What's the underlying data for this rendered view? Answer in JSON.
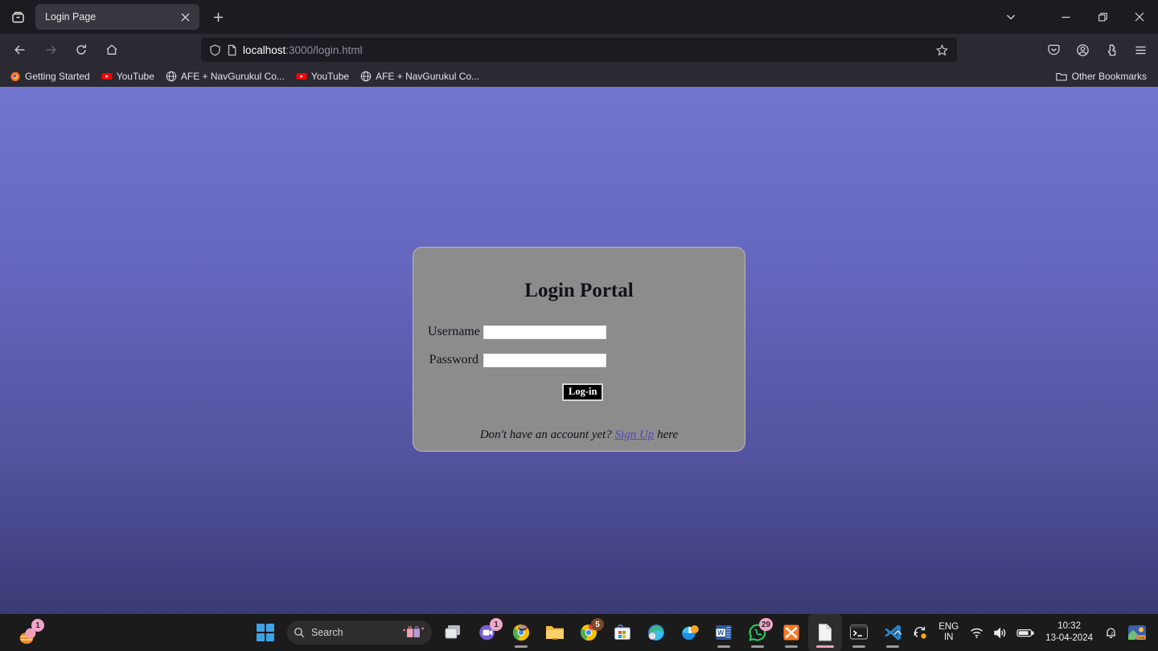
{
  "browser": {
    "window_controls": [
      {
        "name": "list-all-tabs",
        "icon": "chevron-down-icon"
      },
      {
        "name": "minimize",
        "icon": "minimize-icon"
      },
      {
        "name": "maximize",
        "icon": "restore-icon"
      },
      {
        "name": "close",
        "icon": "close-icon"
      }
    ],
    "firefox_view_tooltip": "Firefox View",
    "tab": {
      "title": "Login Page",
      "close_label": "×"
    },
    "new_tab_label": "+",
    "nav": {
      "back": "back-arrow",
      "forward": "forward-arrow",
      "reload": "reload-icon",
      "home": "home-icon"
    },
    "url": {
      "host": "localhost",
      "path": ":3000/login.html",
      "full": "localhost:3000/login.html",
      "shield_icon": "shield-icon",
      "page_icon": "page-icon",
      "bookmark_star": "star-icon"
    },
    "toolbar_right": [
      {
        "name": "pocket-icon",
        "label": "Save to Pocket"
      },
      {
        "name": "account-icon",
        "label": "Account"
      },
      {
        "name": "extensions-icon",
        "label": "Extensions"
      },
      {
        "name": "menu-icon",
        "label": "Open application menu"
      }
    ],
    "bookmarks": [
      {
        "label": "Getting Started",
        "icon": "firefox-icon"
      },
      {
        "label": "YouTube",
        "icon": "youtube-icon"
      },
      {
        "label": "AFE + NavGurukul Co...",
        "icon": "globe-icon"
      },
      {
        "label": "YouTube",
        "icon": "youtube-icon"
      },
      {
        "label": "AFE + NavGurukul Co...",
        "icon": "globe-icon"
      }
    ],
    "other_bookmarks": {
      "label": "Other Bookmarks",
      "icon": "folder-icon"
    }
  },
  "page": {
    "background_top": "#7175ce",
    "background_bottom": "#3a3a74",
    "card": {
      "background": "#8c8c8c",
      "title": "Login Portal",
      "fields": [
        {
          "label": "Username",
          "value": "",
          "placeholder": "",
          "type": "text"
        },
        {
          "label": "Password",
          "value": "",
          "placeholder": "",
          "type": "password"
        }
      ],
      "submit_label": "Log-in",
      "footer": {
        "prefix": "Don't have an account yet?",
        "link": "Sign Up",
        "suffix": "here",
        "link_color": "#4b48c4"
      }
    }
  },
  "taskbar": {
    "corner_app": {
      "name": "notification-app",
      "badge": "1"
    },
    "start_label": "Start",
    "search": {
      "placeholder": "Search",
      "icon": "search-icon"
    },
    "items": [
      {
        "name": "task-view",
        "badge": "",
        "active": false
      },
      {
        "name": "teams",
        "badge": "1",
        "active": false
      },
      {
        "name": "chrome-dev",
        "badge": "",
        "active": true
      },
      {
        "name": "file-explorer",
        "badge": "",
        "active": false
      },
      {
        "name": "chrome",
        "badge": "5",
        "active": false
      },
      {
        "name": "microsoft-store",
        "badge": "",
        "active": false
      },
      {
        "name": "edge",
        "badge": "",
        "active": false
      },
      {
        "name": "paint-3d",
        "badge": "",
        "active": false
      },
      {
        "name": "word",
        "badge": "",
        "active": true
      },
      {
        "name": "whatsapp",
        "badge": "29",
        "active": true
      },
      {
        "name": "xampp",
        "badge": "",
        "active": true
      },
      {
        "name": "notepad",
        "badge": "",
        "active": true,
        "focused": true
      },
      {
        "name": "terminal",
        "badge": "",
        "active": true
      },
      {
        "name": "vs-code",
        "badge": "",
        "active": true
      }
    ],
    "tray": {
      "overflow_icon": "chevron-up-icon",
      "update_icon": "sync-icon",
      "language": {
        "line1": "ENG",
        "line2": "IN"
      },
      "wifi_icon": "wifi-icon",
      "volume_icon": "volume-icon",
      "battery_icon": "battery-icon",
      "clock": {
        "time": "10:32",
        "date": "13-04-2024"
      },
      "notification_icon": "bell-icon",
      "avatar": "user-avatar"
    }
  }
}
